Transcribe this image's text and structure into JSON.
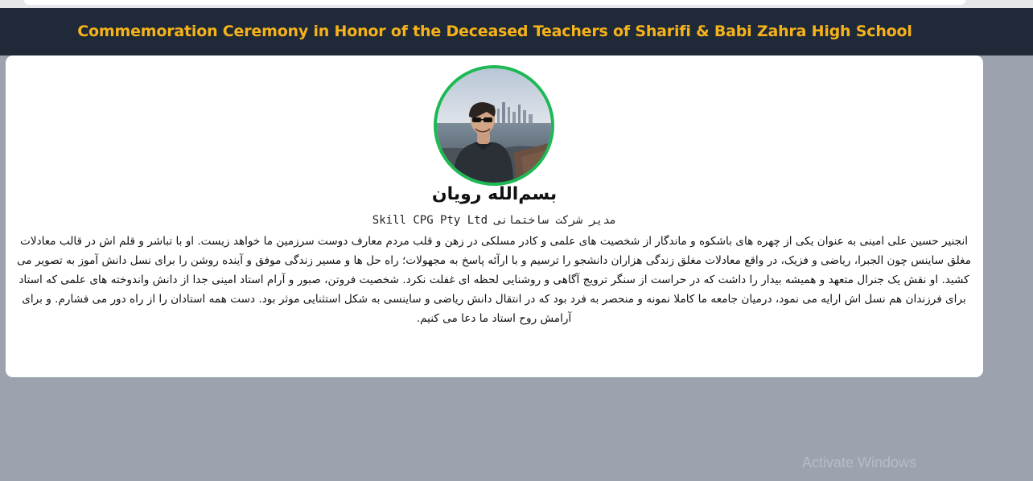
{
  "header": {
    "title": "Commemoration Ceremony in Honor of the Deceased Teachers of Sharifi & Babi Zahra High School"
  },
  "profile": {
    "name": "بسم‌الله رویان",
    "subtitle": "مدیر شرکت ساختمانی Skill CPG Pty Ltd",
    "bio": "انجنیر حسین علی امینی به عنوان یکی از چهره های باشکوه و ماندگار از شخصیت های علمی و کادر مسلکی در زهن و قلب مردم معارف دوست سرزمین ما خواهد زیست. او با تباشر و قلم اش در قالب معادلات مغلق ساینس چون الجبرا، ریاضی و فزیک، در واقع معادلات مغلق زندگی هزاران دانشجو را ترسیم و با ارآئه پاسخ به مجهولات؛ راه حل ها و مسیر زندگی موفق و آینده روشن را برای نسل دانش آموز به تصویر می کشید. او نقش یک جنرال متعهد و همیشه بیدار را داشت که در حراست از سنگر ترویج آگاهی و روشنایی لحظه ای غفلت نکرد. شخصیت فروتن، صبور و آرام استاد امینی جدا از دانش واندوخته های علمی که استاد برای فرزندان هم نسل اش ارایه می نمود، درمیان جامعه ما کاملا نمونه و منحصر به فرد بود که در انتقال دانش ریاضی و ساینسی به شکل استثنایی موثر بود. دست همه استادان را از راه دور می فشارم. و برای آرامش روح استاد ما دعا می کنیم."
  },
  "watermark": {
    "text": "Activate Windows"
  },
  "colors": {
    "header_bg": "#1f2937",
    "header_text": "#f5b21b",
    "avatar_border": "#1db954",
    "page_bg": "#9ca3af"
  }
}
